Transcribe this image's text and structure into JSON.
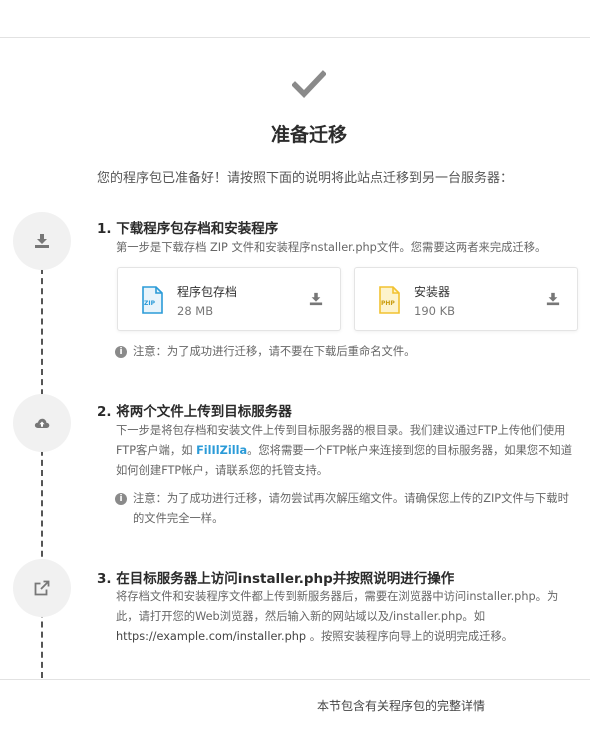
{
  "page": {
    "title": "准备迁移",
    "intro": "您的程序包已准备好！请按照下面的说明将此站点迁移到另一台服务器："
  },
  "steps": [
    {
      "title": "1. 下载程序包存档和安装程序",
      "desc": "第一步是下载存档 ZIP 文件和安装程序nstaller.php文件。您需要这两者来完成迁移。",
      "icon": "download-icon",
      "note": "注意：为了成功进行迁移，请不要在下载后重命名文件。"
    },
    {
      "title": "2. 将两个文件上传到目标服务器",
      "desc_before_link": "下一步是将包存档和安装文件上传到目标服务器的根目录。我们建议通过FTP上传他们使用FTP客户端，如 ",
      "link": "FilIlZilla",
      "desc_after_link": "。您将需要一个FTP帐户来连接到您的目标服务器，如果您不知道如何创建FTP帐户，请联系您的托管支持。",
      "icon": "cloud-upload-icon",
      "note": "注意：为了成功进行迁移，请勿尝试再次解压缩文件。请确保您上传的ZIP文件与下载时的文件完全一样。"
    },
    {
      "title": "3. 在目标服务器上访问installer.php并按照说明进行操作",
      "desc_before_url": "将存档文件和安装程序文件都上传到新服务器后，需要在浏览器中访问installer.php。为此，请打开您的Web浏览器，然后输入新的网站域以及/installer.php。如",
      "url": "https://example.com/installer.php",
      "desc_after_url": " 。按照安装程序向导上的说明完成迁移。",
      "icon": "external-link-icon"
    }
  ],
  "files": [
    {
      "name": "程序包存档",
      "size": "28 MB",
      "icon_label": "ZIP",
      "icon": "zip-file-icon",
      "color": "#2b9bd8"
    },
    {
      "name": "安装器",
      "size": "190 KB",
      "icon_label": "PHP",
      "icon": "php-file-icon",
      "color": "#f2c230"
    }
  ],
  "note_icon": "i",
  "footer": "本节包含有关程序包的完整详情",
  "colors": {
    "accent": "#2b9bd8",
    "check": "#8a8a8a",
    "timeline": "#555555"
  }
}
